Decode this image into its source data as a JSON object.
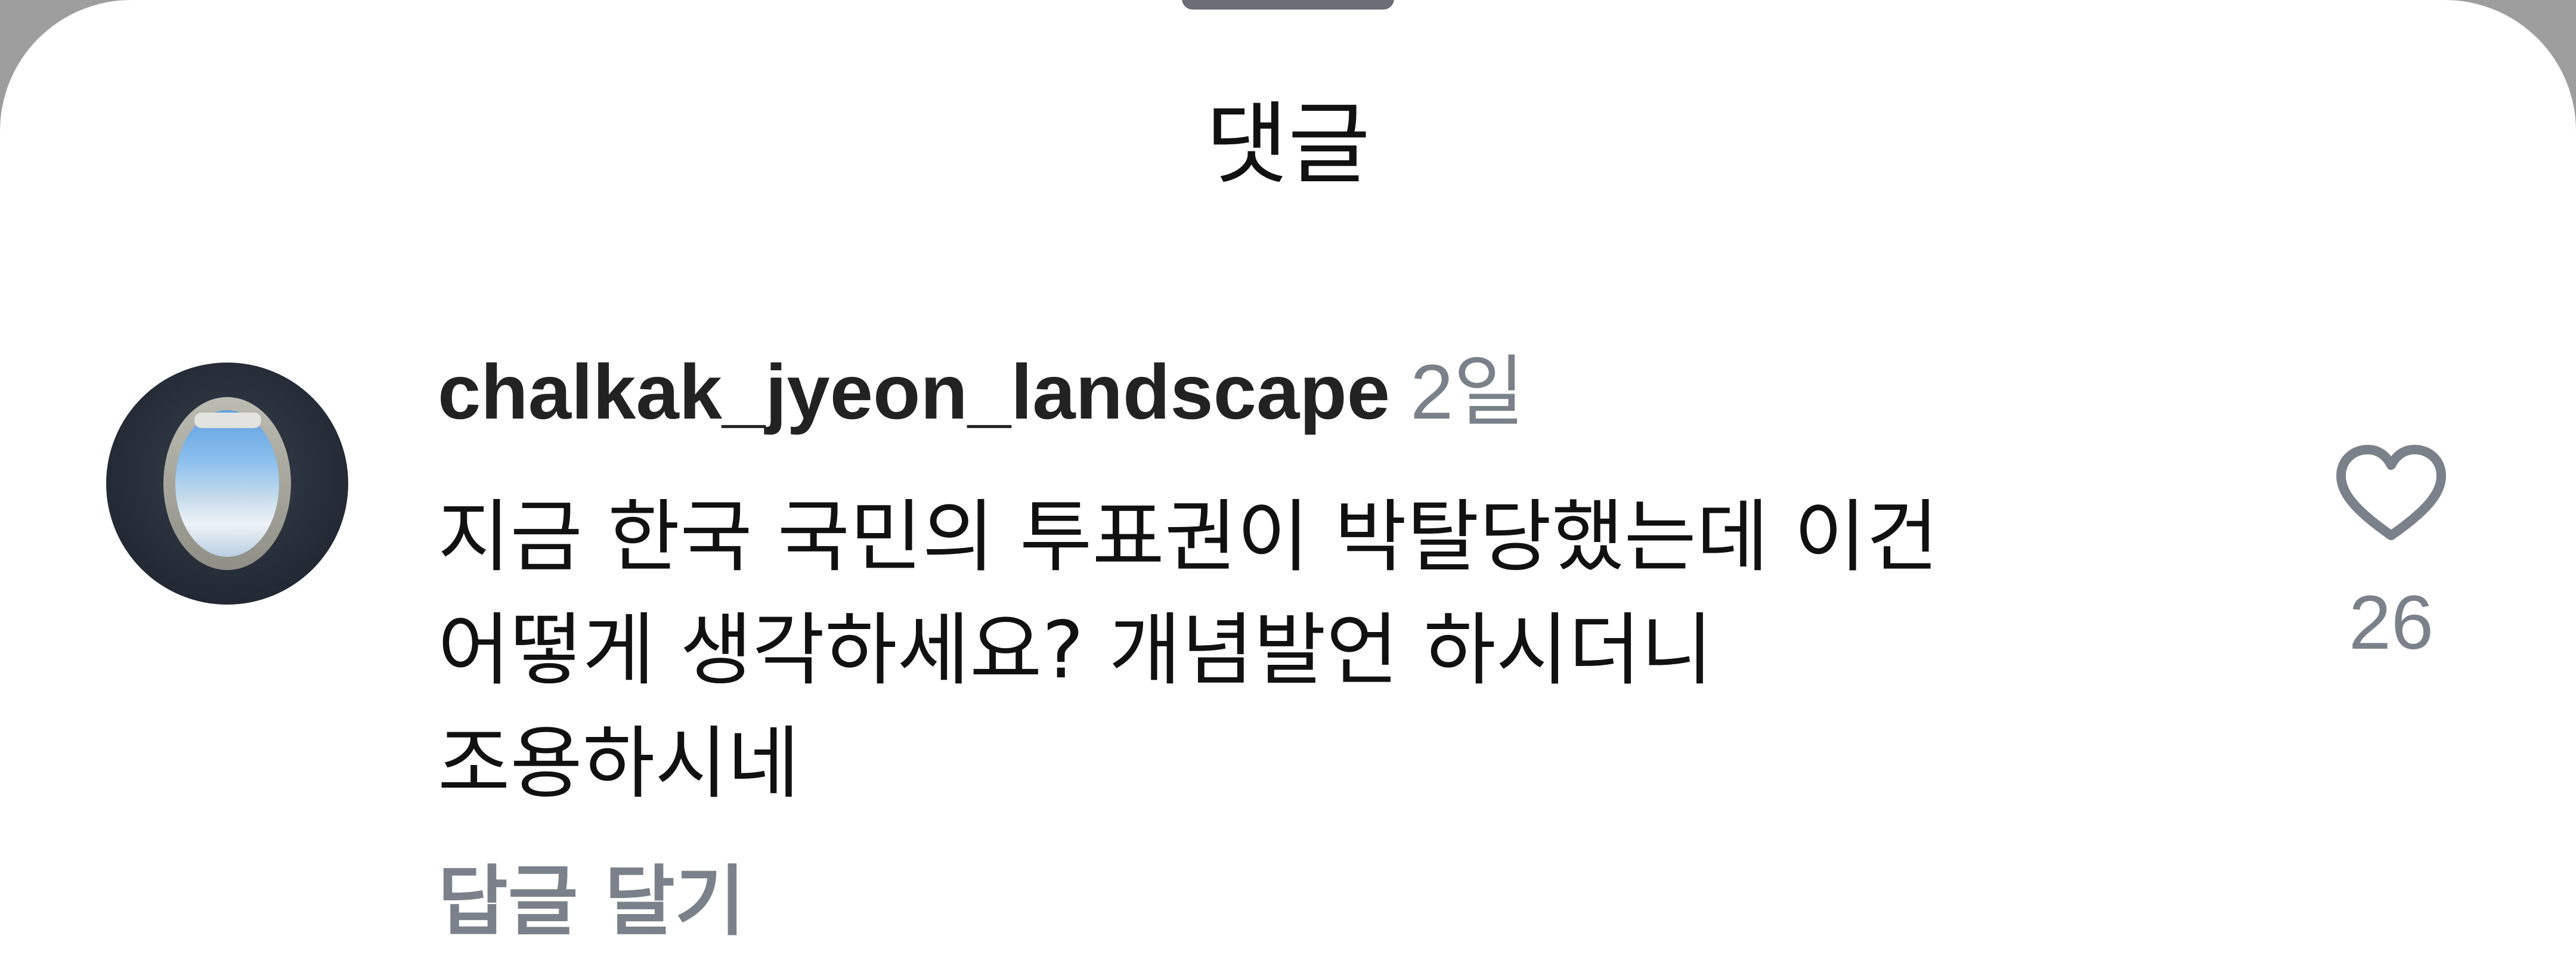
{
  "sheet": {
    "title": "댓글"
  },
  "comment": {
    "username": "chalkak_jyeon_landscape",
    "time": "2일",
    "text_lines": [
      "지금 한국 국민의 투표권이 박탈당했는데 이건",
      "어떻게 생각하세요?  개념발언 하시더니",
      "조용하시네"
    ],
    "reply_label": "답글 달기",
    "like_count": "26",
    "like_icon": "heart-outline-icon",
    "avatar_icon": "airplane-window-photo"
  },
  "colors": {
    "background": "#ffffff",
    "text": "#111111",
    "muted": "#7b818a",
    "handle": "#6b6e75"
  }
}
